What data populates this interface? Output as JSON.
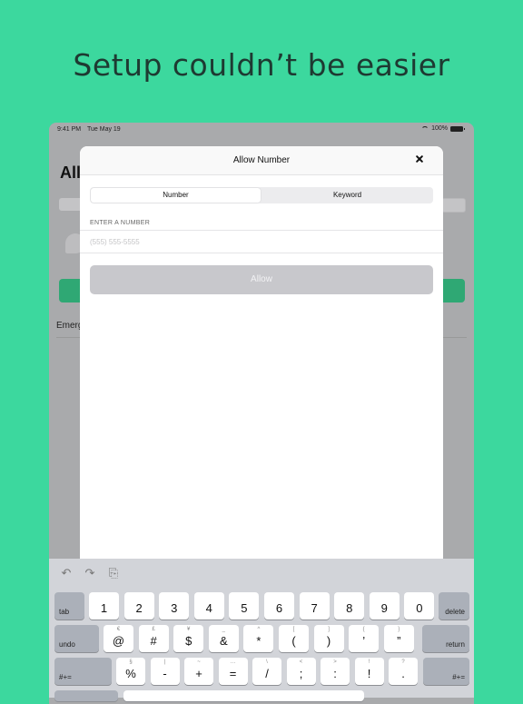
{
  "headline": "Setup couldn’t be easier",
  "status_bar": {
    "time": "9:41 PM",
    "date": "Tue May 19",
    "battery": "100%"
  },
  "background_app": {
    "title_partial": "All",
    "emergency_partial": "Emerg"
  },
  "modal": {
    "title": "Allow Number",
    "tabs": [
      {
        "label": "Number",
        "active": true
      },
      {
        "label": "Keyword",
        "active": false
      }
    ],
    "field_label": "ENTER A NUMBER",
    "field_placeholder": "(555) 555-5555",
    "field_value": "",
    "allow_label": "Allow"
  },
  "keyboard": {
    "tools": [
      "undo-arrow-icon",
      "redo-arrow-icon",
      "clipboard-icon"
    ],
    "row1": {
      "left": "tab",
      "keys": [
        "1",
        "2",
        "3",
        "4",
        "5",
        "6",
        "7",
        "8",
        "9",
        "0"
      ],
      "right": "delete"
    },
    "row2": {
      "left": "undo",
      "keys": [
        {
          "main": "@",
          "alt": "€"
        },
        {
          "main": "#",
          "alt": "£"
        },
        {
          "main": "$",
          "alt": "¥"
        },
        {
          "main": "&",
          "alt": "_"
        },
        {
          "main": "*",
          "alt": "^"
        },
        {
          "main": "(",
          "alt": "["
        },
        {
          "main": ")",
          "alt": "]"
        },
        {
          "main": "’",
          "alt": "{"
        },
        {
          "main": "”",
          "alt": "}"
        }
      ],
      "right": "return"
    },
    "row3": {
      "left": "#+=",
      "keys": [
        {
          "main": "%",
          "alt": "§"
        },
        {
          "main": "-",
          "alt": "|"
        },
        {
          "main": "+",
          "alt": "~"
        },
        {
          "main": "=",
          "alt": "…"
        },
        {
          "main": "/",
          "alt": "\\"
        },
        {
          "main": ";",
          "alt": "<"
        },
        {
          "main": ":",
          "alt": ">"
        },
        {
          "main": "!",
          "alt": "!"
        },
        {
          "main": ".",
          "alt": "?"
        }
      ],
      "right": "#+="
    }
  },
  "colors": {
    "background": "#3cd89e",
    "headline": "#1e3a32",
    "allow_button": "#c8c8cc",
    "brand_green": "#2fa874"
  }
}
